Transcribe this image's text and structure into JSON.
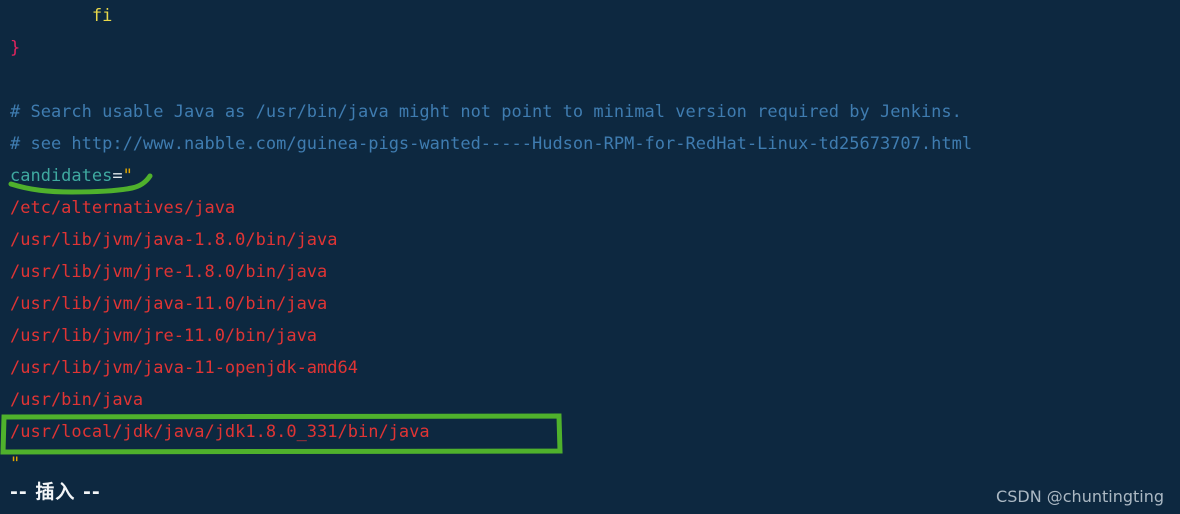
{
  "window": {
    "app": "vim",
    "background_color": "#0d2840"
  },
  "editor": {
    "lines": [
      {
        "indent": "        ",
        "segments": [
          {
            "text": "fi",
            "type": "keyword"
          }
        ]
      },
      {
        "indent": "",
        "segments": [
          {
            "text": "}",
            "type": "brace"
          }
        ]
      },
      {
        "indent": "",
        "segments": [
          {
            "text": "",
            "type": "blank"
          }
        ]
      },
      {
        "indent": "",
        "segments": [
          {
            "text": "# Search usable Java as /usr/bin/java might not point to minimal version required by Jenkins.",
            "type": "comment"
          }
        ]
      },
      {
        "indent": "",
        "segments": [
          {
            "text": "# see http://www.nabble.com/guinea-pigs-wanted-----Hudson-RPM-for-RedHat-Linux-td25673707.html",
            "type": "comment"
          }
        ]
      },
      {
        "indent": "",
        "segments": [
          {
            "text": "candidates",
            "type": "var"
          },
          {
            "text": "=",
            "type": "op"
          },
          {
            "text": "\"",
            "type": "string"
          }
        ]
      },
      {
        "indent": "",
        "segments": [
          {
            "text": "/etc/alternatives/java",
            "type": "path"
          }
        ]
      },
      {
        "indent": "",
        "segments": [
          {
            "text": "/usr/lib/jvm/java-1.8.0/bin/java",
            "type": "path"
          }
        ]
      },
      {
        "indent": "",
        "segments": [
          {
            "text": "/usr/lib/jvm/jre-1.8.0/bin/java",
            "type": "path"
          }
        ]
      },
      {
        "indent": "",
        "segments": [
          {
            "text": "/usr/lib/jvm/java-11.0/bin/java",
            "type": "path"
          }
        ]
      },
      {
        "indent": "",
        "segments": [
          {
            "text": "/usr/lib/jvm/jre-11.0/bin/java",
            "type": "path"
          }
        ]
      },
      {
        "indent": "",
        "segments": [
          {
            "text": "/usr/lib/jvm/java-11-openjdk-amd64",
            "type": "path"
          }
        ]
      },
      {
        "indent": "",
        "segments": [
          {
            "text": "/usr/bin/java",
            "type": "path"
          }
        ]
      },
      {
        "indent": "",
        "segments": [
          {
            "text": "/usr/local/jdk/java/jdk1.8.0_331/bin/java",
            "type": "path"
          }
        ]
      },
      {
        "indent": "",
        "segments": [
          {
            "text": "\"",
            "type": "string"
          }
        ]
      }
    ]
  },
  "status": {
    "mode_text": "-- 插入 --"
  },
  "watermark": {
    "text": "CSDN @chuntingting"
  },
  "annotations": {
    "highlight_color": "#4fb12c",
    "underline": {
      "target_text": "candidates=",
      "shape": "hand-drawn-wavy-underline"
    },
    "box": {
      "target_text": "/usr/local/jdk/java/jdk1.8.0_331/bin/java",
      "shape": "hand-drawn-rectangle"
    }
  },
  "colors": {
    "keyword": "#e8d84a",
    "brace": "#e3245e",
    "comment": "#3f7cb0",
    "variable": "#3fa9a0",
    "operator": "#dfe6ea",
    "string": "#e0a500",
    "path": "#e03434",
    "status_text": "#f2f5f7",
    "watermark_text": "#b9c5cf"
  }
}
